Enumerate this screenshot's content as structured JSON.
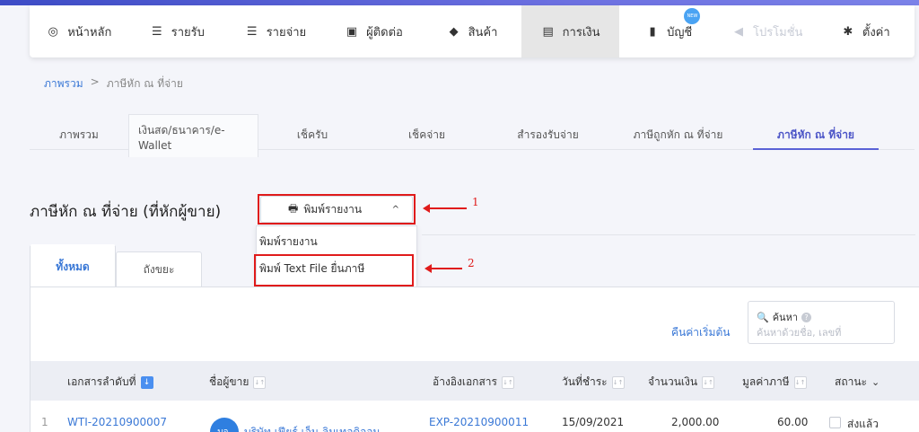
{
  "nav": [
    {
      "label": "หน้าหลัก",
      "icon": "dashboard-icon",
      "glyph": "◎"
    },
    {
      "label": "รายรับ",
      "icon": "income-list-icon",
      "glyph": "☰"
    },
    {
      "label": "รายจ่าย",
      "icon": "expense-list-icon",
      "glyph": "☰"
    },
    {
      "label": "ผู้ติดต่อ",
      "icon": "contacts-icon",
      "glyph": "▣"
    },
    {
      "label": "สินค้า",
      "icon": "product-box-icon",
      "glyph": "◆"
    },
    {
      "label": "การเงิน",
      "icon": "money-icon",
      "glyph": "▤"
    },
    {
      "label": "บัญชี",
      "icon": "account-book-icon",
      "glyph": "▮"
    },
    {
      "label": "โปรโมชั่น",
      "icon": "megaphone-icon",
      "glyph": "◀"
    },
    {
      "label": "ตั้งค่า",
      "icon": "gear-icon",
      "glyph": "✱"
    }
  ],
  "nav_badge": "NEW",
  "breadcrumb": {
    "root": "ภาพรวม",
    "sep": ">",
    "current": "ภาษีหัก ณ ที่จ่าย"
  },
  "subtabs": [
    "ภาพรวม",
    "เงินสด/ธนาคาร/e-Wallet",
    "เช็ครับ",
    "เช็คจ่าย",
    "สำรองรับจ่าย",
    "ภาษีถูกหัก ณ ที่จ่าย",
    "ภาษีหัก ณ ที่จ่าย"
  ],
  "page_title": "ภาษีหัก ณ ที่จ่าย (ที่หักผู้ขาย)",
  "print_button": {
    "label": "พิมพ์รายงาน",
    "chevron": "^"
  },
  "menu": [
    "พิมพ์รายงาน",
    "พิมพ์ Text File ยื่นภาษี"
  ],
  "annotations": [
    "1",
    "2"
  ],
  "tabs": [
    "ทั้งหมด",
    "ถังขยะ"
  ],
  "reset_link": "คืนค่าเริ่มต้น",
  "search": {
    "label": "ค้นหา",
    "placeholder": "ค้นหาด้วยชื่อ, เลขที่"
  },
  "columns": [
    "เอกสารลำดับที่",
    "ชื่อผู้ขาย",
    "อ้างอิงเอกสาร",
    "วันที่ชำระ",
    "จำนวนเงิน",
    "มูลค่าภาษี",
    "สถานะ"
  ],
  "row": {
    "index": "1",
    "doc_no": "WTI-20210900007",
    "avatar_text": "บจ.",
    "vendor": "บริษัท เฟียร์ เอ็น ลิมเทอดิจอน",
    "ref": "EXP-20210900011",
    "date": "15/09/2021",
    "amount": "2,000.00",
    "tax": "60.00",
    "status": "ส่งแล้ว"
  },
  "colors": {
    "accent": "#5a62d6",
    "link": "#3a78d6",
    "annotation": "#e01b1b"
  }
}
